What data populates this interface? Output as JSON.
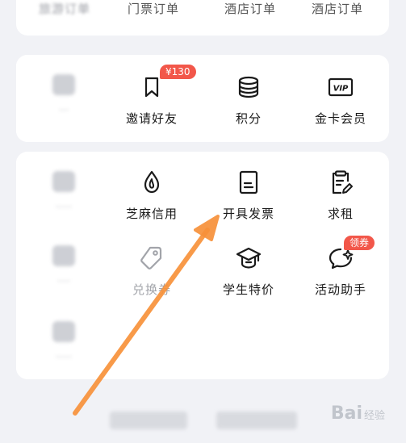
{
  "top_row": {
    "items": [
      {
        "label": "旅游订单"
      },
      {
        "label": "门票订单"
      },
      {
        "label": "酒店订单"
      }
    ]
  },
  "mid_row": {
    "items": [
      {
        "label": "邀请好友",
        "icon": "bookmark-icon",
        "badge": "¥130"
      },
      {
        "label": "积分",
        "icon": "coins-stack-icon"
      },
      {
        "label": "金卡会员",
        "icon": "vip-card-icon",
        "icon_text": "VIP"
      }
    ]
  },
  "bottom_grid": {
    "row1": [
      {
        "label": "芝麻信用",
        "icon": "sesame-drop-icon"
      },
      {
        "label": "开具发票",
        "icon": "invoice-icon"
      },
      {
        "label": "求租",
        "icon": "clipboard-edit-icon"
      }
    ],
    "row2": [
      {
        "label": "兑换券",
        "icon": "coupon-tag-icon"
      },
      {
        "label": "学生特价",
        "icon": "graduation-cap-icon"
      },
      {
        "label": "活动助手",
        "icon": "chat-bubble-icon",
        "badge": "领券"
      }
    ]
  },
  "watermark": {
    "text": "Bai",
    "sub": "经验"
  },
  "colors": {
    "accent": "#f2574a",
    "arrow": "#f7913a",
    "background": "#f1f2f6"
  }
}
